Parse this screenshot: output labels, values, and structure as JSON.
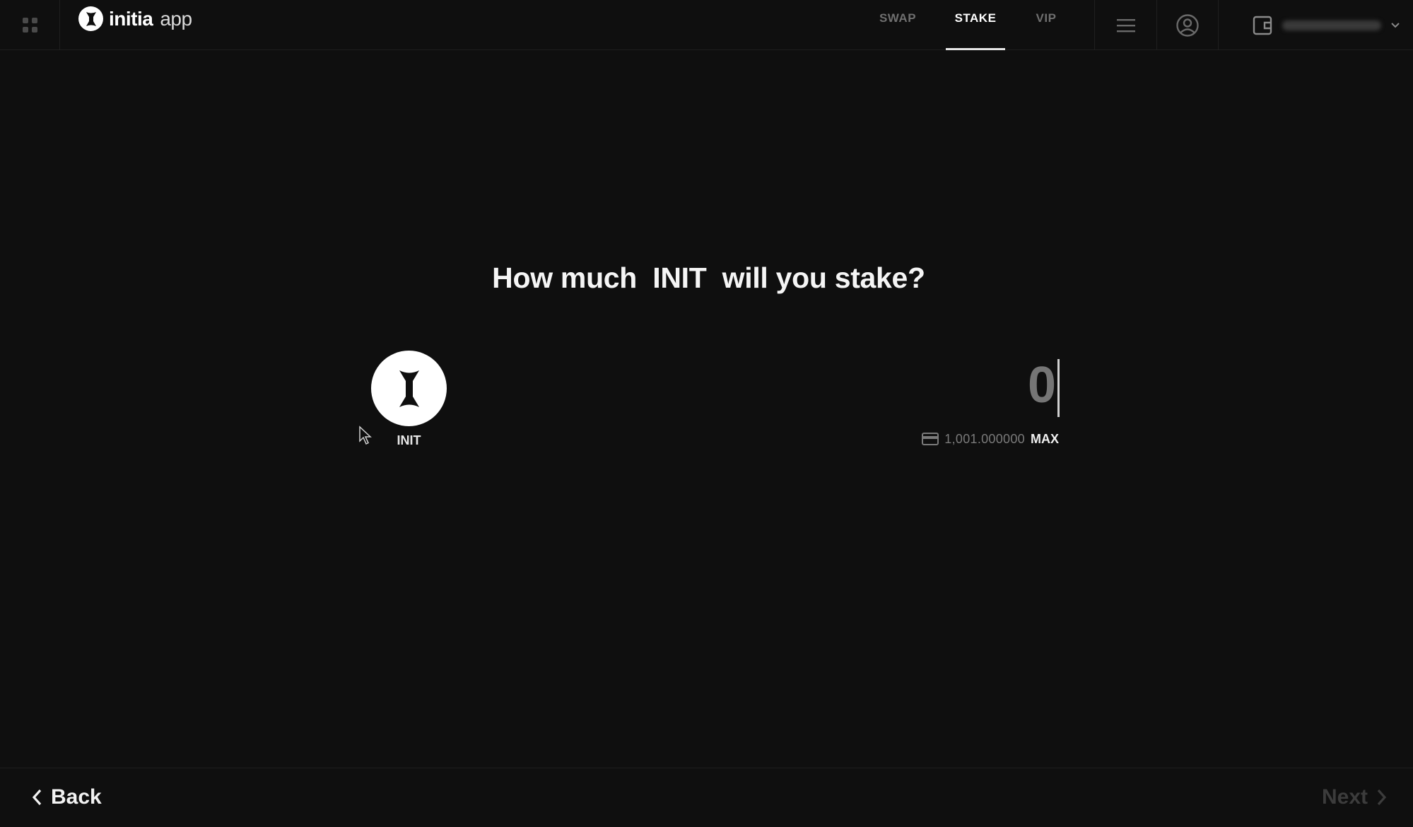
{
  "header": {
    "brand": {
      "name": "initia",
      "suffix": "app",
      "logo_icon": "initia-logo-icon"
    },
    "apps_icon": "grid-icon",
    "nav": [
      {
        "label": "SWAP",
        "active": false
      },
      {
        "label": "STAKE",
        "active": true
      },
      {
        "label": "VIP",
        "active": false
      }
    ],
    "menu_icon": "hamburger-menu-icon",
    "profile_icon": "user-profile-icon",
    "wallet": {
      "icon": "wallet-icon",
      "dropdown_icon": "chevron-down-icon"
    }
  },
  "main": {
    "question": "How much  INIT  will you stake?",
    "token": {
      "symbol": "INIT",
      "icon": "init-token-icon"
    },
    "amount": {
      "value": "0",
      "placeholder": "0"
    },
    "balance": {
      "icon": "wallet-balance-icon",
      "value": "1,001.000000",
      "max_label": "MAX"
    }
  },
  "footer": {
    "back_label": "Back",
    "next_label": "Next",
    "next_enabled": false
  },
  "colors": {
    "background": "#0f0f0f",
    "text": "#f2f2f2",
    "muted": "#6f6f6f",
    "disabled": "#3c3c3c"
  }
}
